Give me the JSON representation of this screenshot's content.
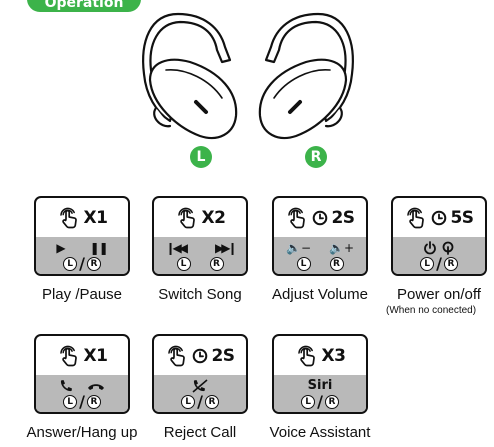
{
  "banner": {
    "label": "Operation"
  },
  "earbuds": {
    "left_badge": "L",
    "right_badge": "R"
  },
  "lr": {
    "left": "L",
    "right": "R",
    "slash": "/"
  },
  "cards": [
    {
      "count": "X1",
      "timer": false,
      "caption": "Play /Pause"
    },
    {
      "count": "X2",
      "timer": false,
      "caption": "Switch Song"
    },
    {
      "count": "2S",
      "timer": true,
      "caption": "Adjust Volume",
      "vol_minus": "−",
      "vol_plus": "+"
    },
    {
      "count": "5S",
      "timer": true,
      "caption": "Power on/off",
      "note": "(When no conected)"
    },
    {
      "count": "X1",
      "timer": false,
      "caption": "Answer/Hang up"
    },
    {
      "count": "2S",
      "timer": true,
      "caption": "Reject Call"
    },
    {
      "count": "X3",
      "timer": false,
      "caption": "Voice Assistant",
      "text": "Siri"
    }
  ],
  "colors": {
    "accent": "#3cb34a",
    "panel": "#b9b9b9",
    "ink": "#111111"
  }
}
